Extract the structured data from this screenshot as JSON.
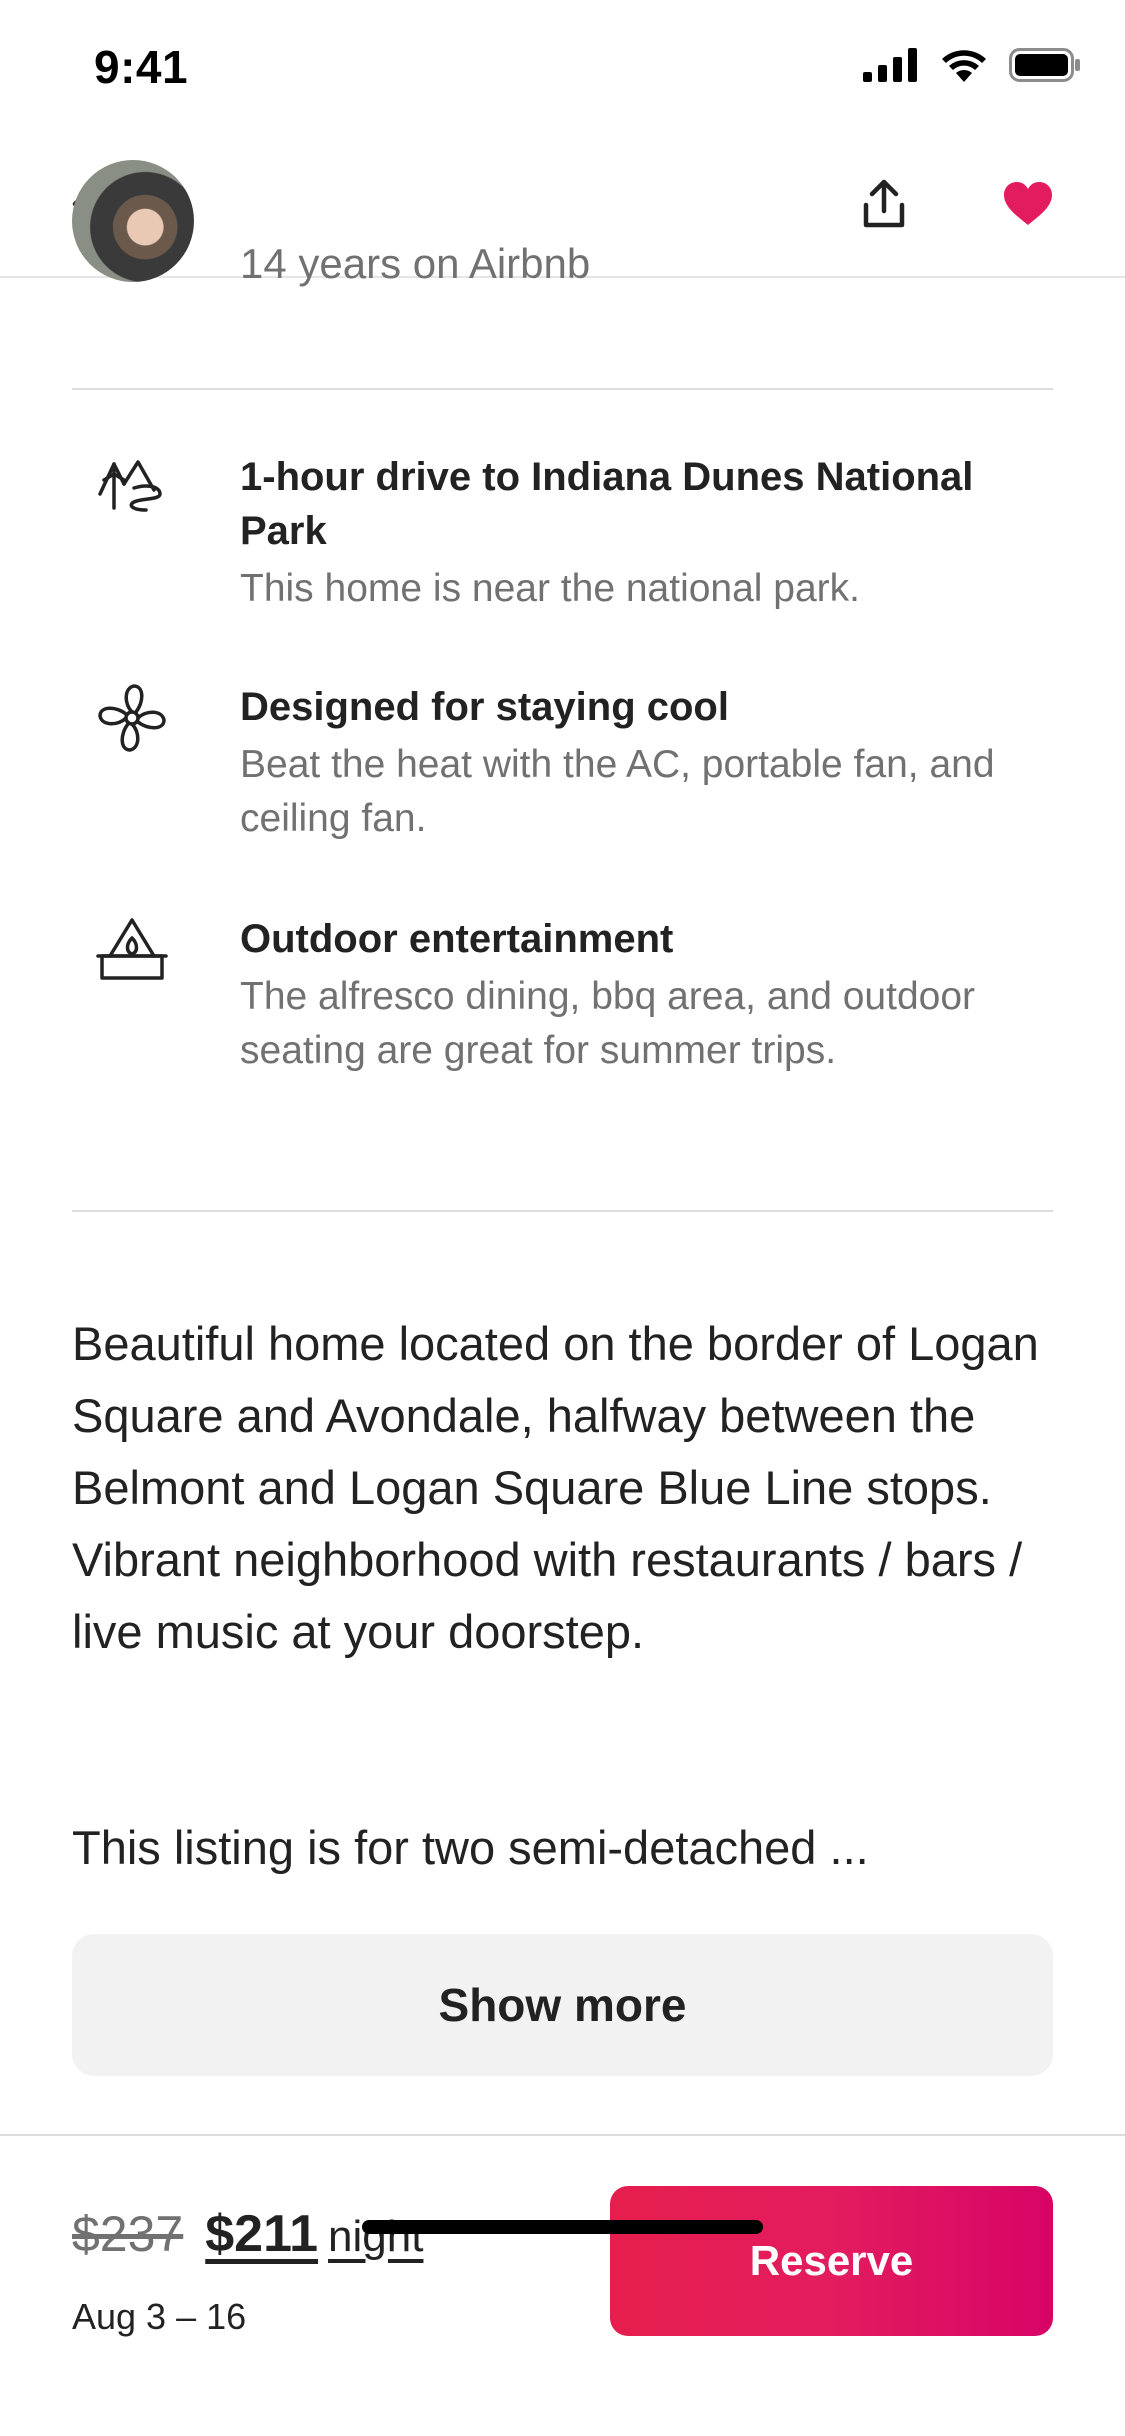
{
  "status_bar": {
    "time": "9:41"
  },
  "nav": {
    "back_icon": "arrow-left-icon",
    "share_icon": "share-icon",
    "favorite_icon": "heart-filled-icon",
    "favorite_color": "#e31c5f"
  },
  "host": {
    "years": "14 years on Airbnb"
  },
  "highlights": [
    {
      "icon": "mountain-icon",
      "title": "1-hour drive to Indiana Dunes National Park",
      "subtitle": "This home is near the national park."
    },
    {
      "icon": "fan-icon",
      "title": "Designed for staying cool",
      "subtitle": "Beat the heat with the AC, portable fan, and ceiling fan."
    },
    {
      "icon": "firepit-icon",
      "title": "Outdoor entertainment",
      "subtitle": "The alfresco dining, bbq area, and outdoor seating are great for summer trips."
    }
  ],
  "description": {
    "text": "Beautiful home located on the border of Logan Square and Avondale, halfway between the Belmont and Logan Square Blue Line stops. Vibrant neighborhood with restaurants / bars / live music at your doorstep.",
    "extra": "This listing is for two semi-detached ...",
    "show_more_label": "Show more"
  },
  "booking": {
    "original_price": "$237",
    "price": "$211",
    "unit": "night",
    "dates": "Aug 3 – 16",
    "reserve_label": "Reserve",
    "accent_color": "#e31c5f"
  }
}
